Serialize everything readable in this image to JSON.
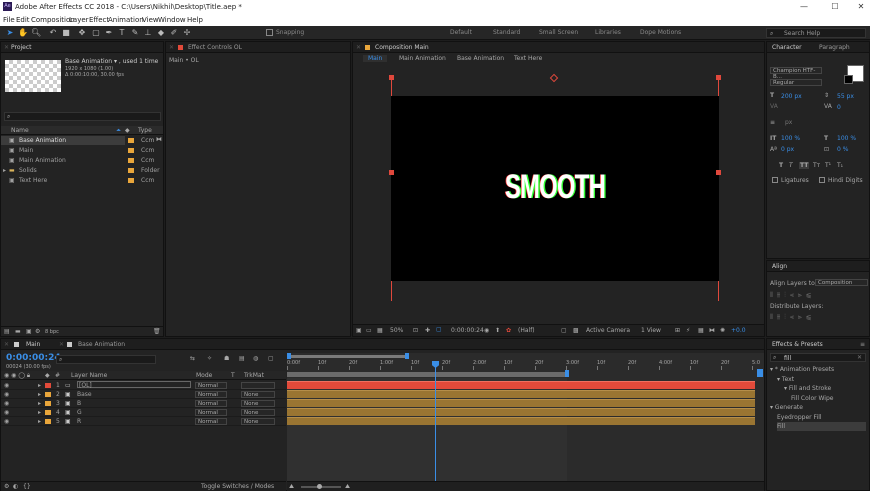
{
  "window": {
    "title": "Adobe After Effects CC 2018 - C:\\Users\\Nikhil\\Desktop\\Title.aep *",
    "app_icon": "Ae",
    "min": "—",
    "max": "☐",
    "close": "✕"
  },
  "menu": [
    "File",
    "Edit",
    "Composition",
    "Layer",
    "Effect",
    "Animation",
    "View",
    "Window",
    "Help"
  ],
  "toolbar": {
    "snapping": "Snapping",
    "workspaces": [
      "Default",
      "Standard",
      "Small Screen",
      "Libraries",
      "Dope Motions"
    ],
    "search_help": "Search Help"
  },
  "project": {
    "tab": "Project",
    "name": "Base Animation ▾ , used 1 time",
    "info1": "1920 x 1080 (1.00)",
    "info2": "Δ 0:00:10:00, 30.00 fps",
    "col_name": "Name",
    "col_type": "Type",
    "items": [
      {
        "name": "Base Animation",
        "type": "Ccm",
        "selected": true,
        "folder": false
      },
      {
        "name": "Main",
        "type": "Ccm",
        "folder": false
      },
      {
        "name": "Main Animation",
        "type": "Ccm",
        "folder": false
      },
      {
        "name": "Solids",
        "type": "Folder",
        "folder": true
      },
      {
        "name": "Text Here",
        "type": "Ccm",
        "folder": false
      }
    ],
    "bpc": "8 bpc"
  },
  "effect_controls": {
    "tab": "Effect Controls OL",
    "target": "Main • OL"
  },
  "composition": {
    "tab": "Composition Main",
    "subtabs": [
      "Main",
      "Main Animation",
      "Base Animation",
      "Text Here"
    ],
    "canvas_text": "SMOOTH",
    "footer": {
      "zoom": "50%",
      "time": "0:00:00:24",
      "res": "(Half)",
      "camera": "Active Camera",
      "view": "1 View",
      "exposure": "+0.0"
    }
  },
  "character": {
    "tab": "Character",
    "tab2": "Paragraph",
    "font": "Champion HTF-B...",
    "style": "Regular",
    "size": "200 px",
    "leading": "55 px",
    "tracking": "0",
    "vscale": "100 %",
    "hscale": "100 %",
    "baseline": "0 px",
    "tsume": "0 %",
    "unit": "px",
    "buttons": [
      "T",
      "T",
      "TT",
      "Tт",
      "T¹",
      "T₁"
    ],
    "ligatures": "Ligatures",
    "hindi": "Hindi Digits"
  },
  "align": {
    "tab": "Align",
    "layers_to": "Align Layers to:",
    "target": "Composition",
    "distribute": "Distribute Layers:"
  },
  "effects": {
    "tab": "Effects & Presets",
    "search": "fill",
    "tree": [
      {
        "label": "▾ * Animation Presets",
        "indent": 0
      },
      {
        "label": "▾ Text",
        "indent": 1
      },
      {
        "label": "▾ Fill and Stroke",
        "indent": 2
      },
      {
        "label": "Fill Color Wipe",
        "indent": 3
      },
      {
        "label": "▾ Generate",
        "indent": 0
      },
      {
        "label": "Eyedropper Fill",
        "indent": 1
      },
      {
        "label": "Fill",
        "indent": 1
      }
    ]
  },
  "timeline": {
    "tabs": [
      "Main",
      "Base Animation"
    ],
    "timecode": "0:00:00:24",
    "fps": "00024 (30.00 fps)",
    "search_placeholder": "",
    "columns": {
      "num": "#",
      "name": "Layer Name",
      "mode": "Mode",
      "t": "T",
      "trkmat": "TrkMat"
    },
    "ticks": [
      "0:00f",
      "10f",
      "20f",
      "1:00f",
      "10f",
      "20f",
      "2:00f",
      "10f",
      "20f",
      "3:00f",
      "10f",
      "20f",
      "4:00f",
      "10f",
      "20f",
      "5:0"
    ],
    "toggle": "Toggle Switches / Modes",
    "layers": [
      {
        "num": "1",
        "name": "[OL]",
        "mode": "Normal",
        "trkmat": "",
        "color": "#e24a3a"
      },
      {
        "num": "2",
        "name": "Base",
        "mode": "Normal",
        "trkmat": "None",
        "color": "#e9a63b"
      },
      {
        "num": "3",
        "name": "B",
        "mode": "Normal",
        "trkmat": "None",
        "color": "#e9a63b"
      },
      {
        "num": "4",
        "name": "G",
        "mode": "Normal",
        "trkmat": "None",
        "color": "#e9a63b"
      },
      {
        "num": "5",
        "name": "R",
        "mode": "Normal",
        "trkmat": "None",
        "color": "#e9a63b"
      }
    ]
  },
  "colors": {
    "accent": "#3a8ee6",
    "layer_red": "#e24a3a",
    "layer_gold": "#9a7532",
    "orange": "#e9a63b"
  }
}
